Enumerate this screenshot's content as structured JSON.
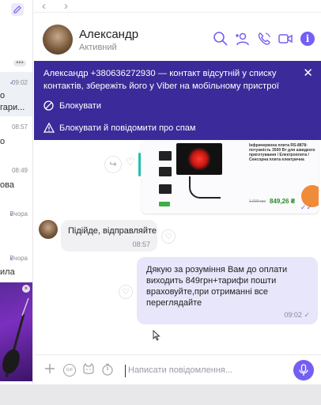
{
  "sidebar": {
    "dots": "•••",
    "items": [
      {
        "time": "09:02",
        "text": "о",
        "text2": "гари..."
      },
      {
        "time": "08:57",
        "text": "о"
      },
      {
        "time": "08:49",
        "text": "ова"
      },
      {
        "time": "Вчора",
        "text": ""
      },
      {
        "time": "Вчора",
        "text": "ила"
      }
    ]
  },
  "header": {
    "name": "Александр",
    "status": "Активний",
    "info_label": "i"
  },
  "banner": {
    "message": "Александр +380636272930 — контакт відсутній у списку контактів, збережіть його у Viber на мобільному пристрої",
    "block_label": "Блокувати",
    "block_spam_label": "Блокувати й повідомити про спам",
    "close": "✕"
  },
  "messages": {
    "image_message": {
      "title": "Інфрачервона плита RS-8878: потужність 3500 Вт для швидкого приготування / Електроплита / Сенсорна плита електрична",
      "old_price": "1 099 грн",
      "price": "849,26 ₴",
      "ticks": "✓✓"
    },
    "incoming": {
      "text": "Підійде, відправляйте",
      "time": "08:57"
    },
    "outgoing": {
      "text": "Дякую за розуміння Вам до оплати виходить 849грн+тарифи пошти враховуйте,при  отриманні все переглядайте",
      "time": "09:02",
      "tick": "✓"
    }
  },
  "composer": {
    "placeholder": "Написати повідомлення...",
    "gif": "GIF"
  },
  "colors": {
    "accent": "#7360f2",
    "banner": "#3b2a99",
    "outgoing_bubble": "#e7e6fb",
    "incoming_bubble": "#f1f1f4"
  }
}
